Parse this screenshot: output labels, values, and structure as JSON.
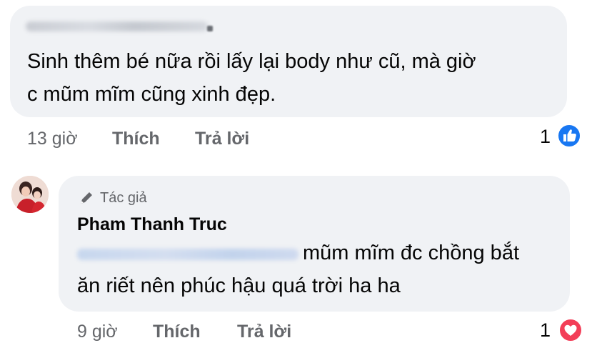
{
  "comment1": {
    "text_line1": "Sinh thêm bé nữa rồi lấy lại body như cũ, mà giờ",
    "text_line2": "c mũm mĩm cũng xinh đẹp.",
    "time": "13 giờ",
    "like_label": "Thích",
    "reply_label": "Trả lời",
    "reaction_count": "1",
    "reaction_icon": "like-icon",
    "reaction_color": "#1877f2"
  },
  "comment2": {
    "author_badge": "Tác giả",
    "author_name": "Pham Thanh Truc",
    "text_line1": "mũm mĩm đc chồng bắt",
    "text_line2": "ăn riết nên phúc hậu quá trời ha ha",
    "time": "9 giờ",
    "like_label": "Thích",
    "reply_label": "Trả lời",
    "reaction_count": "1",
    "reaction_icon": "love-icon",
    "reaction_color": "#f33e58"
  },
  "colors": {
    "bubble_bg": "#f0f2f5",
    "meta_text": "#65676b",
    "body_text": "#050505"
  }
}
